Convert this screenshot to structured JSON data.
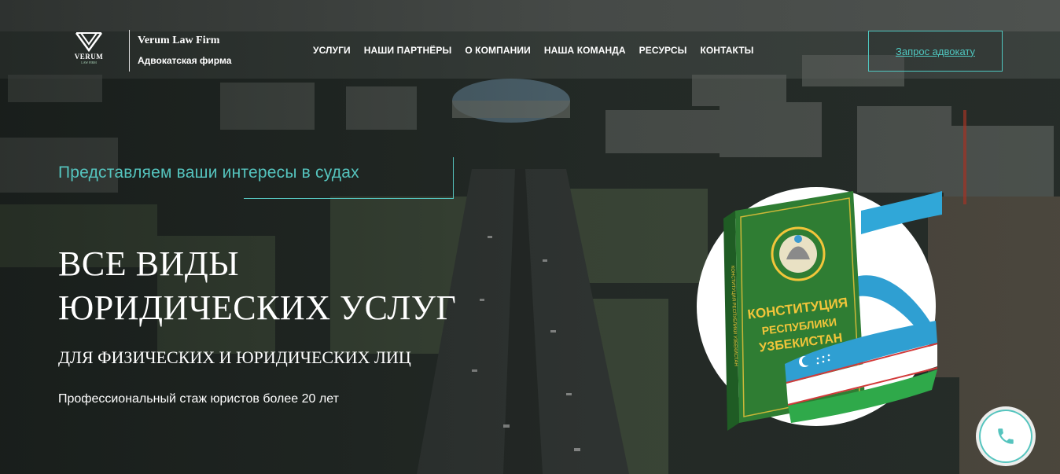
{
  "brand": {
    "logo_text": "VERUM",
    "logo_subtext": "LAW FIRM",
    "name": "Verum Law Firm",
    "tagline": "Адвокатская фирма"
  },
  "nav": {
    "items": [
      "УСЛУГИ",
      "НАШИ ПАРТНЁРЫ",
      "О КОМПАНИИ",
      "НАША КОМАНДА",
      "РЕСУРСЫ",
      "КОНТАКТЫ"
    ]
  },
  "cta_label": "Запрос адвокату",
  "hero": {
    "tagline": "Представляем ваши интересы в судах",
    "headline_line1": "ВСЕ ВИДЫ",
    "headline_line2": "ЮРИДИЧЕСКИХ УСЛУГ",
    "subheadline": "ДЛЯ ФИЗИЧЕСКИХ И ЮРИДИЧЕСКИХ ЛИЦ",
    "experience": "Профессиональный стаж юристов более 20 лет"
  },
  "book": {
    "title_line1": "КОНСТИТУЦИЯ",
    "title_line2": "РЕСПУБЛИКИ",
    "title_line3": "УЗБЕКИСТАН",
    "spine": "КОНСТИТУЦИЯ РЕСПУБЛИКИ УЗБЕКИСТАН"
  },
  "icons": {
    "logo": "verum-logo-icon",
    "phone": "phone-icon"
  },
  "colors": {
    "accent": "#55c4be",
    "book_green": "#2f7d33",
    "book_gold": "#f2c53a"
  }
}
